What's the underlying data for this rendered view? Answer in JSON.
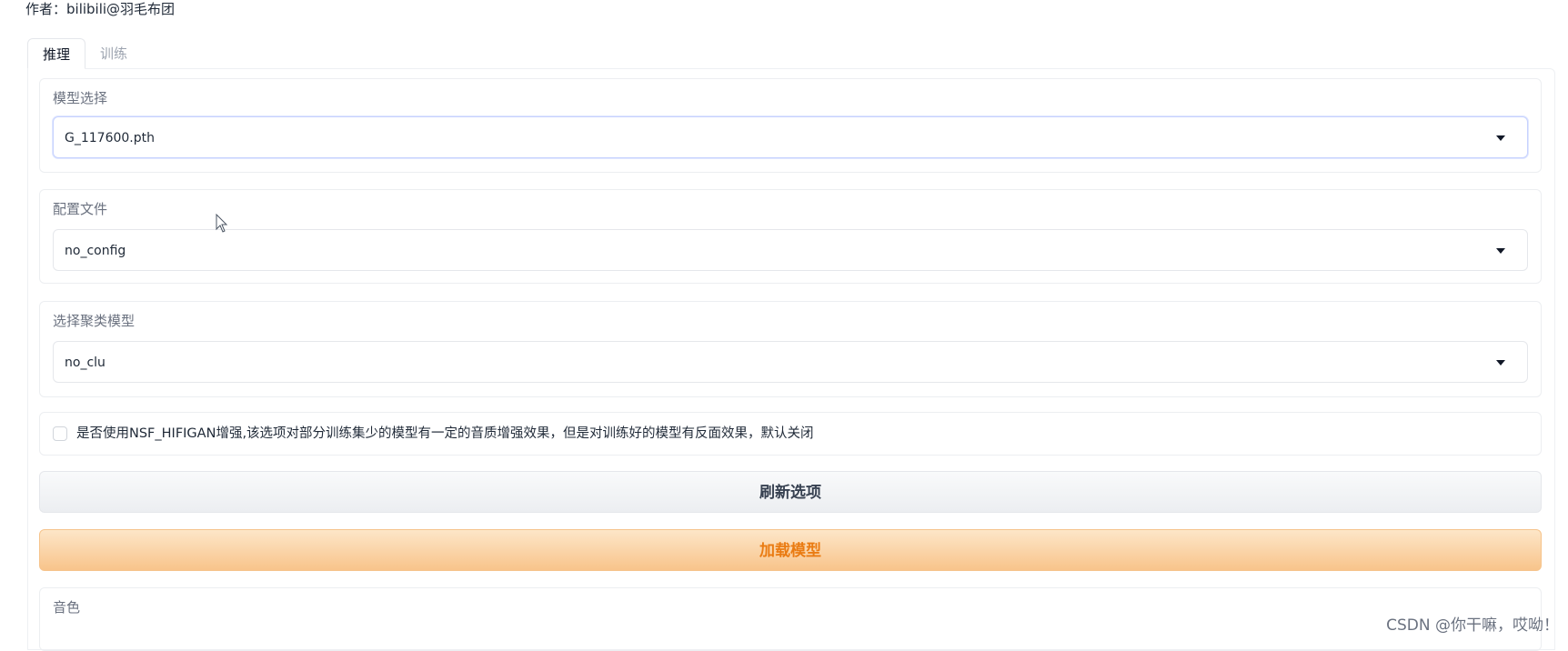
{
  "header": {
    "author": "作者：bilibili@羽毛布团"
  },
  "tabs": [
    {
      "label": "推理",
      "active": true
    },
    {
      "label": "训练",
      "active": false
    }
  ],
  "model_select": {
    "label": "模型选择",
    "value": "G_117600.pth"
  },
  "config_file": {
    "label": "配置文件",
    "value": "no_config"
  },
  "cluster_model": {
    "label": "选择聚类模型",
    "value": "no_clu"
  },
  "nsf_option": {
    "label": "是否使用NSF_HIFIGAN增强,该选项对部分训练集少的模型有一定的音质增强效果，但是对训练好的模型有反面效果，默认关闭",
    "checked": false
  },
  "buttons": {
    "refresh": "刷新选项",
    "load_model": "加载模型"
  },
  "timbre": {
    "label": "音色"
  },
  "watermark": "CSDN @你干嘛，哎呦！",
  "colors": {
    "load_button_text": "#ea7b12",
    "load_button_bg": "#f8c48b",
    "refresh_button_bg": "#eceef1"
  }
}
